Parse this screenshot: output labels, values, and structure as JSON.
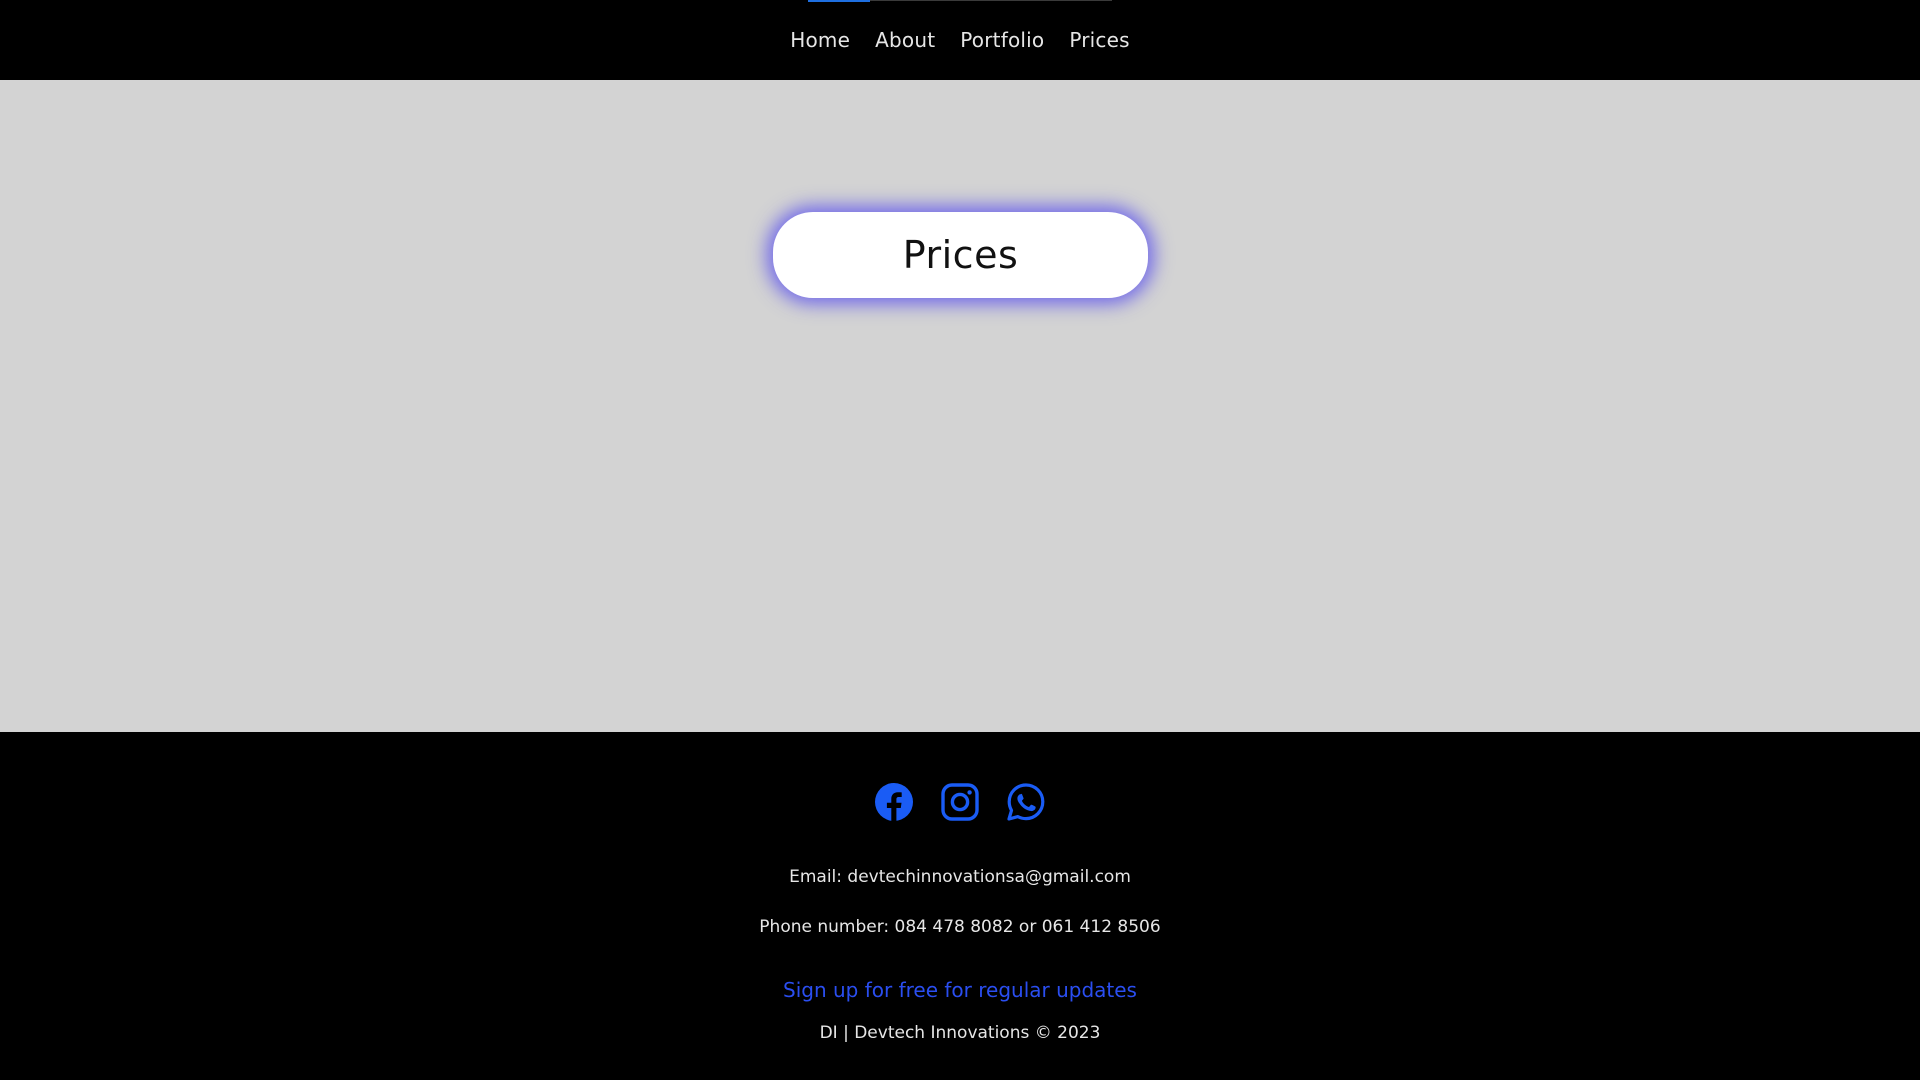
{
  "nav": {
    "items": [
      {
        "label": "Home"
      },
      {
        "label": "About"
      },
      {
        "label": "Portfolio"
      },
      {
        "label": "Prices"
      }
    ]
  },
  "main": {
    "title": "Prices"
  },
  "footer": {
    "social": [
      {
        "icon": "facebook-icon"
      },
      {
        "icon": "instagram-icon"
      },
      {
        "icon": "whatsapp-icon"
      }
    ],
    "email_text": "Email: devtechinnovationsa@gmail.com",
    "phone_text": "Phone number: 084 478 8082 or 061 412 8506",
    "signup_link": "Sign up for free for regular updates",
    "copyright": "DI | Devtech Innovations © 2023"
  },
  "colors": {
    "header_bg": "#000000",
    "main_bg": "#d3d3d3",
    "accent_blue": "#1a5cf5",
    "glow": "#5046f0",
    "link_blue": "#2a4ef0"
  }
}
